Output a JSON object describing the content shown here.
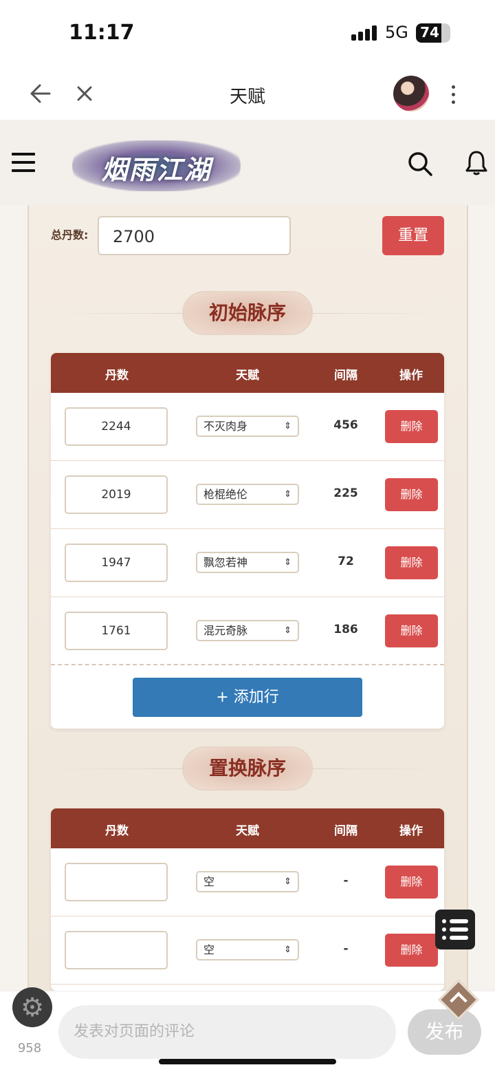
{
  "status_bar": {
    "time": "11:17",
    "network": "5G",
    "battery": "74",
    "battery_level": 0.74,
    "signal_bars": 4
  },
  "nav": {
    "title": "天赋",
    "back_icon": "arrow-left-icon",
    "close_icon": "close-icon",
    "more_icon": "more-vertical-icon"
  },
  "site": {
    "logo_text": "烟雨江湖",
    "menu_icon": "menu-icon",
    "search_icon": "search-icon",
    "bell_icon": "bell-icon"
  },
  "total": {
    "label": "总丹数:",
    "value": "2700",
    "reset_label": "重置"
  },
  "initial": {
    "title": "初始脉序",
    "headers": {
      "dan": "丹数",
      "talent": "天赋",
      "gap": "间隔",
      "op": "操作"
    },
    "rows": [
      {
        "dan": "2244",
        "talent": "不灭肉身",
        "gap": "456",
        "delete": "删除"
      },
      {
        "dan": "2019",
        "talent": "枪棍绝伦",
        "gap": "225",
        "delete": "删除"
      },
      {
        "dan": "1947",
        "talent": "飘忽若神",
        "gap": "72",
        "delete": "删除"
      },
      {
        "dan": "1761",
        "talent": "混元奇脉",
        "gap": "186",
        "delete": "删除"
      }
    ],
    "add_row_label": "+ 添加行"
  },
  "replace": {
    "title": "置换脉序",
    "headers": {
      "dan": "丹数",
      "talent": "天赋",
      "gap": "间隔",
      "op": "操作"
    },
    "rows": [
      {
        "dan": "",
        "talent": "空",
        "gap": "-",
        "delete": "删除"
      },
      {
        "dan": "",
        "talent": "空",
        "gap": "-",
        "delete": "删除"
      }
    ]
  },
  "bottom": {
    "comment_placeholder": "发表对页面的评论",
    "post_label": "发布",
    "count": "958",
    "settings_icon": "gear-icon",
    "list_icon": "list-icon",
    "top_icon": "back-to-top-icon"
  },
  "colors": {
    "header_red": "#8f3a2a",
    "button_red": "#d84e4e",
    "button_blue": "#337ab7",
    "title_red": "#8a2e22"
  }
}
